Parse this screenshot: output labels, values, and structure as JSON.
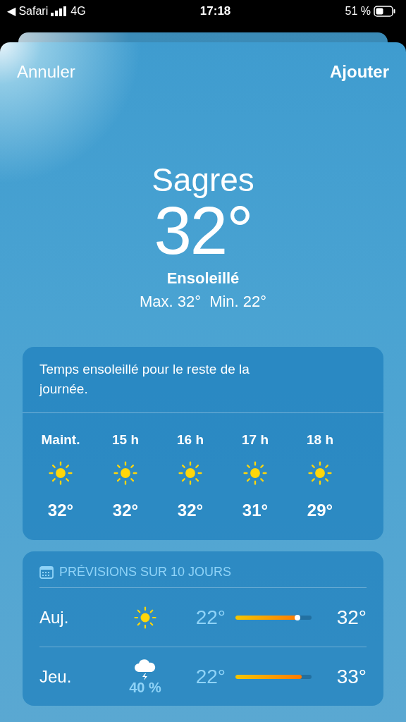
{
  "status_bar": {
    "back_app": "◀ Safari",
    "network": "4G",
    "time": "17:18",
    "battery_text": "51 %"
  },
  "nav": {
    "cancel": "Annuler",
    "add": "Ajouter"
  },
  "current": {
    "city": "Sagres",
    "temperature": "32°",
    "condition": "Ensoleillé",
    "high_low": "Max. 32°  Min. 22°"
  },
  "hourly": {
    "summary": "Temps ensoleillé pour le reste de la journée.",
    "hours": [
      {
        "label": "Maint.",
        "kind": "sun",
        "temp": "32°"
      },
      {
        "label": "15 h",
        "kind": "sun",
        "temp": "32°"
      },
      {
        "label": "16 h",
        "kind": "sun",
        "temp": "32°"
      },
      {
        "label": "17 h",
        "kind": "sun",
        "temp": "31°"
      },
      {
        "label": "18 h",
        "kind": "sun",
        "temp": "29°"
      }
    ]
  },
  "forecast": {
    "title": "PRÉVISIONS SUR 10 JOURS",
    "days": [
      {
        "day": "Auj.",
        "kind": "sun",
        "low": "22°",
        "high": "32°",
        "level": 0.83,
        "now_marker": true
      },
      {
        "day": "Jeu.",
        "kind": "storm",
        "precip": "40 %",
        "low": "22°",
        "high": "33°",
        "level": 0.87,
        "now_marker": false
      }
    ]
  }
}
